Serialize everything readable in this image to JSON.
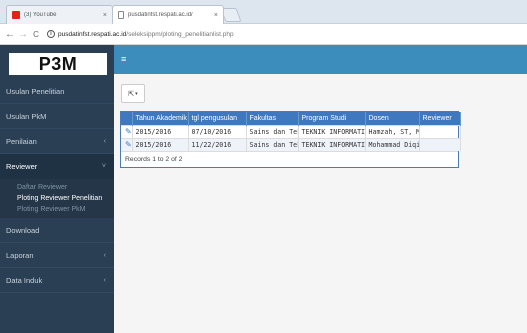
{
  "browser": {
    "tabs": [
      {
        "title": "(3) YouTube",
        "close": "×",
        "favicon": "youtube-icon"
      },
      {
        "title": "pusdatinfst.respati.ac.id/",
        "close": "×",
        "favicon": "page-icon"
      }
    ],
    "nav": {
      "back": "←",
      "forward": "→",
      "reload": "C"
    },
    "url_host": "pusdatinfst.respati.ac.id",
    "url_path": "/seleksippm/ploting_penelitianlist.php"
  },
  "sidebar": {
    "logo": "P3M",
    "items": [
      {
        "label": "Usulan Penelitian",
        "chevron": ""
      },
      {
        "label": "Usulan PkM",
        "chevron": ""
      },
      {
        "label": "Penilaian",
        "chevron": "‹"
      },
      {
        "label": "Reviewer",
        "chevron": "˅"
      },
      {
        "label": "Download",
        "chevron": ""
      },
      {
        "label": "Laporan",
        "chevron": "‹"
      },
      {
        "label": "Data Induk",
        "chevron": "‹"
      }
    ],
    "reviewer_submenu": [
      {
        "label": "Daftar Reviewer"
      },
      {
        "label": "Ploting Reviewer Penelitian"
      },
      {
        "label": "Ploting Reviewer PkM"
      }
    ]
  },
  "topbar": {
    "menu_icon": "≡"
  },
  "toolbar": {
    "export_icon": "⇱",
    "export_caret": "▾"
  },
  "grid": {
    "columns": [
      "",
      "Tahun Akademik",
      "tgl pengusulan",
      "Fakultas",
      "Program Studi",
      "Dosen",
      "Reviewer"
    ],
    "rows": [
      {
        "edit": "✎",
        "tahun": "2015/2016",
        "tgl": "07/10/2016",
        "fakultas": "Sains dan Teknologi",
        "prodi": "TEKNIK INFORMATIKA",
        "dosen": "Hamzah, ST, MT",
        "reviewer": ""
      },
      {
        "edit": "✎",
        "tahun": "2015/2016",
        "tgl": "11/22/2016",
        "fakultas": "Sains dan Teknologi",
        "prodi": "TEKNIK INFORMATIKA",
        "dosen": "Mohammad Diqi",
        "reviewer": ""
      }
    ],
    "footer": "Records 1 to 2 of 2"
  },
  "colors": {
    "sidebar_bg": "#2a3f54",
    "topbar_bg": "#3c8dbc",
    "grid_header": "#3f78bf"
  }
}
